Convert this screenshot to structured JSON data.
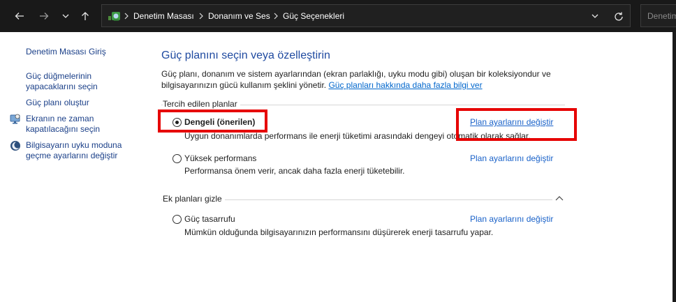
{
  "address_bar": {
    "breadcrumbs": [
      "Denetim Masası",
      "Donanım ve Ses",
      "Güç Seçenekleri"
    ],
    "search_placeholder": "Denetim"
  },
  "sidebar": {
    "home": "Denetim Masası Giriş",
    "items": [
      {
        "label1": "Güç düğmelerinin",
        "label2": "yapacaklarını seçin"
      },
      {
        "label1": "Güç planı oluştur"
      },
      {
        "label1": "Ekranın ne zaman",
        "label2": "kapatılacağını seçin",
        "icon": "monitor-icon"
      },
      {
        "label1": "Bilgisayarın uyku moduna",
        "label2": "geçme ayarlarını değiştir",
        "icon": "moon-icon"
      }
    ]
  },
  "main": {
    "title": "Güç planını seçin veya özelleştirin",
    "intro_text": "Güç planı, donanım ve sistem ayarlarından (ekran parlaklığı, uyku modu gibi) oluşan bir koleksiyondur ve bilgisayarınızın gücü kullanım şeklini yönetir.",
    "intro_link": "Güç planları hakkında daha fazla bilgi ver",
    "preferred_section": "Tercih edilen planlar",
    "extra_section": "Ek planları gizle",
    "change_link": "Plan ayarlarını değiştir",
    "plans": [
      {
        "name": "Dengeli (önerilen)",
        "desc": "Uygun donanımlarda performans ile enerji tüketimi arasındaki dengeyi otomatik olarak sağlar.",
        "selected": true
      },
      {
        "name": "Yüksek performans",
        "desc": "Performansa önem verir, ancak daha fazla enerji tüketebilir.",
        "selected": false
      },
      {
        "name": "Güç tasarrufu",
        "desc": "Mümkün olduğunda bilgisayarınızın performansını düşürerek enerji tasarrufu yapar.",
        "selected": false
      }
    ]
  },
  "colors": {
    "highlight": "#e60000",
    "link": "#1a62c9",
    "title": "#1f4aa0",
    "toolbar_bg": "#191919"
  }
}
